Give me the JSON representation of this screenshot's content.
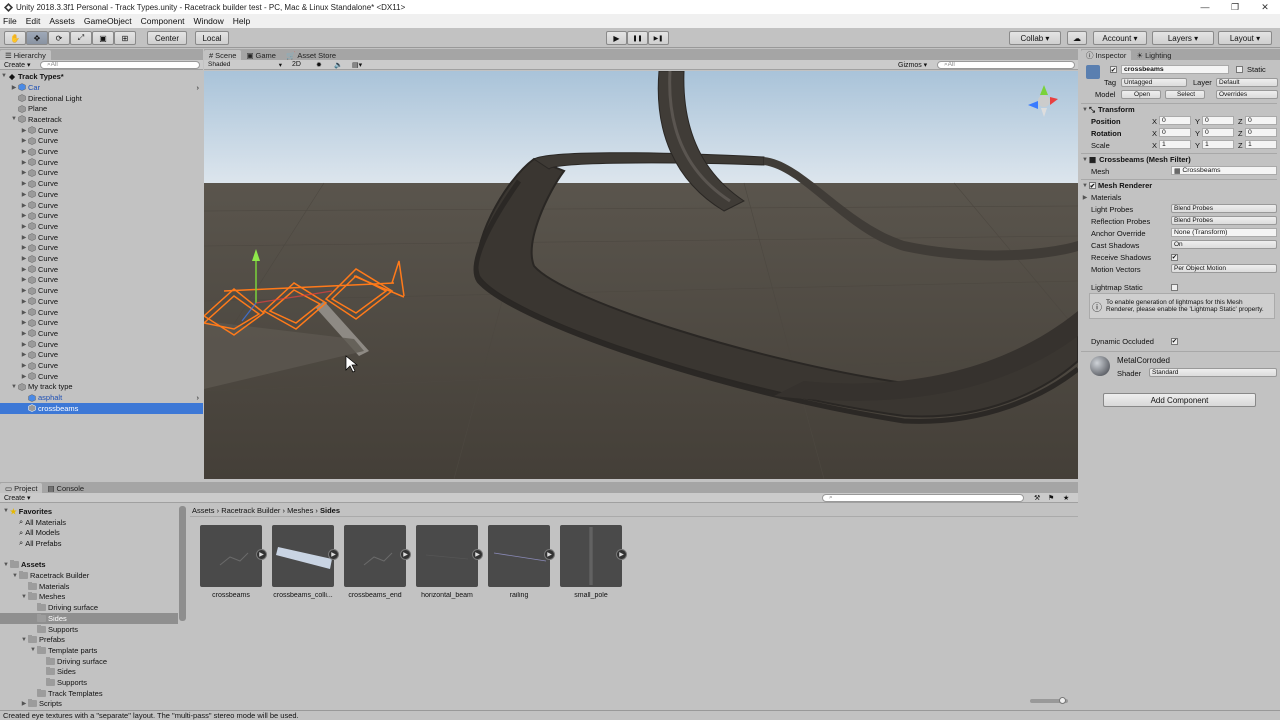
{
  "window": {
    "title": "Unity 2018.3.3f1 Personal - Track Types.unity - Racetrack builder test - PC, Mac & Linux Standalone* <DX11>",
    "controls": [
      "—",
      "❐",
      "✕"
    ]
  },
  "menu": [
    "File",
    "Edit",
    "Assets",
    "GameObject",
    "Component",
    "Window",
    "Help"
  ],
  "toolbar": {
    "pivot": "Center",
    "space": "Local",
    "collab": "Collab ▾",
    "account": "Account",
    "layers": "Layers",
    "layout": "Layout"
  },
  "hierarchy": {
    "tab": "Hierarchy",
    "create": "Create ▾",
    "search_placeholder": "All",
    "scene": "Track Types*",
    "rows": [
      {
        "label": "Car",
        "indent": 1,
        "tri": "▶",
        "blue": true
      },
      {
        "label": "Directional Light",
        "indent": 1,
        "tri": ""
      },
      {
        "label": "Plane",
        "indent": 1,
        "tri": ""
      },
      {
        "label": "Racetrack",
        "indent": 1,
        "tri": "▼"
      },
      {
        "label": "Curve",
        "indent": 2,
        "tri": "▶"
      },
      {
        "label": "Curve",
        "indent": 2,
        "tri": "▶"
      },
      {
        "label": "Curve",
        "indent": 2,
        "tri": "▶"
      },
      {
        "label": "Curve",
        "indent": 2,
        "tri": "▶"
      },
      {
        "label": "Curve",
        "indent": 2,
        "tri": "▶"
      },
      {
        "label": "Curve",
        "indent": 2,
        "tri": "▶"
      },
      {
        "label": "Curve",
        "indent": 2,
        "tri": "▶"
      },
      {
        "label": "Curve",
        "indent": 2,
        "tri": "▶"
      },
      {
        "label": "Curve",
        "indent": 2,
        "tri": "▶"
      },
      {
        "label": "Curve",
        "indent": 2,
        "tri": "▶"
      },
      {
        "label": "Curve",
        "indent": 2,
        "tri": "▶"
      },
      {
        "label": "Curve",
        "indent": 2,
        "tri": "▶"
      },
      {
        "label": "Curve",
        "indent": 2,
        "tri": "▶"
      },
      {
        "label": "Curve",
        "indent": 2,
        "tri": "▶"
      },
      {
        "label": "Curve",
        "indent": 2,
        "tri": "▶"
      },
      {
        "label": "Curve",
        "indent": 2,
        "tri": "▶"
      },
      {
        "label": "Curve",
        "indent": 2,
        "tri": "▶"
      },
      {
        "label": "Curve",
        "indent": 2,
        "tri": "▶"
      },
      {
        "label": "Curve",
        "indent": 2,
        "tri": "▶"
      },
      {
        "label": "Curve",
        "indent": 2,
        "tri": "▶"
      },
      {
        "label": "Curve",
        "indent": 2,
        "tri": "▶"
      },
      {
        "label": "Curve",
        "indent": 2,
        "tri": "▶"
      },
      {
        "label": "Curve",
        "indent": 2,
        "tri": "▶"
      },
      {
        "label": "Curve",
        "indent": 2,
        "tri": "▶"
      },
      {
        "label": "My track type",
        "indent": 1,
        "tri": "▼"
      },
      {
        "label": "asphalt",
        "indent": 2,
        "tri": "",
        "blue": true
      },
      {
        "label": "crossbeams",
        "indent": 2,
        "tri": "",
        "selected": true
      }
    ]
  },
  "scene": {
    "tabs": [
      "Scene",
      "Game",
      "Asset Store"
    ],
    "shading": "Shaded",
    "mode2d": "2D",
    "gizmos": "Gizmos ▾",
    "search_placeholder": "All"
  },
  "play": {
    "play": "▶",
    "pause": "❚❚",
    "step": "▶❚"
  },
  "inspector": {
    "tabs": [
      "Inspector",
      "Lighting"
    ],
    "name": "crossbeams",
    "static": "Static",
    "tag_label": "Tag",
    "tag": "Untagged",
    "layer_label": "Layer",
    "layer": "Default",
    "model_label": "Model",
    "open": "Open",
    "select": "Select",
    "overrides": "Overrides",
    "transform": {
      "title": "Transform",
      "position": "Position",
      "rotation": "Rotation",
      "scale": "Scale",
      "pos": [
        "0",
        "0",
        "0"
      ],
      "rot": [
        "0",
        "0",
        "0"
      ],
      "scl": [
        "1",
        "1",
        "1"
      ],
      "axes": [
        "X",
        "Y",
        "Z"
      ]
    },
    "meshfilter": {
      "title": "Crossbeams (Mesh Filter)",
      "mesh_label": "Mesh",
      "mesh": "Crossbeams"
    },
    "renderer": {
      "title": "Mesh Renderer",
      "materials": "Materials",
      "rows": [
        {
          "label": "Light Probes",
          "value": "Blend Probes"
        },
        {
          "label": "Reflection Probes",
          "value": "Blend Probes"
        },
        {
          "label": "Anchor Override",
          "value": "None (Transform)"
        },
        {
          "label": "Cast Shadows",
          "value": "On"
        },
        {
          "label": "Receive Shadows",
          "value": "✔"
        },
        {
          "label": "Motion Vectors",
          "value": "Per Object Motion"
        }
      ],
      "lightmap_static": "Lightmap Static",
      "info": "To enable generation of lightmaps for this Mesh Renderer, please enable the 'Lightmap Static' property.",
      "dynamic_occluded": "Dynamic Occluded"
    },
    "material": {
      "name": "MetalCorroded",
      "shader_label": "Shader",
      "shader": "Standard"
    },
    "add_component": "Add Component"
  },
  "project": {
    "tabs": [
      "Project",
      "Console"
    ],
    "create": "Create ▾",
    "breadcrumb": [
      "Assets",
      "Racetrack Builder",
      "Meshes",
      "Sides"
    ],
    "tree": [
      {
        "label": "Favorites",
        "indent": 0,
        "tri": "▼",
        "bold": true,
        "fav": true
      },
      {
        "label": "All Materials",
        "indent": 1,
        "tri": "",
        "search": true
      },
      {
        "label": "All Models",
        "indent": 1,
        "tri": "",
        "search": true
      },
      {
        "label": "All Prefabs",
        "indent": 1,
        "tri": "",
        "search": true
      },
      {
        "label": "",
        "indent": 0,
        "tri": ""
      },
      {
        "label": "Assets",
        "indent": 0,
        "tri": "▼",
        "bold": true
      },
      {
        "label": "Racetrack Builder",
        "indent": 1,
        "tri": "▼"
      },
      {
        "label": "Materials",
        "indent": 2,
        "tri": ""
      },
      {
        "label": "Meshes",
        "indent": 2,
        "tri": "▼"
      },
      {
        "label": "Driving surface",
        "indent": 3,
        "tri": ""
      },
      {
        "label": "Sides",
        "indent": 3,
        "tri": "",
        "selected": true
      },
      {
        "label": "Supports",
        "indent": 3,
        "tri": ""
      },
      {
        "label": "Prefabs",
        "indent": 2,
        "tri": "▼"
      },
      {
        "label": "Template parts",
        "indent": 3,
        "tri": "▼"
      },
      {
        "label": "Driving surface",
        "indent": 4,
        "tri": ""
      },
      {
        "label": "Sides",
        "indent": 4,
        "tri": ""
      },
      {
        "label": "Supports",
        "indent": 4,
        "tri": ""
      },
      {
        "label": "Track Templates",
        "indent": 3,
        "tri": ""
      },
      {
        "label": "Scripts",
        "indent": 2,
        "tri": "▶"
      }
    ],
    "assets": [
      "crossbeams",
      "crossbeams_colli...",
      "crossbeams_end",
      "horizontal_beam",
      "railing",
      "small_pole"
    ]
  },
  "status": "Created eye textures with a \"separate\" layout.  The \"multi-pass\" stereo mode will be used.",
  "colors": {
    "accent": "#3d78d6",
    "selection_orange": "#ff7a1a",
    "panel": "#c2c2c2"
  }
}
